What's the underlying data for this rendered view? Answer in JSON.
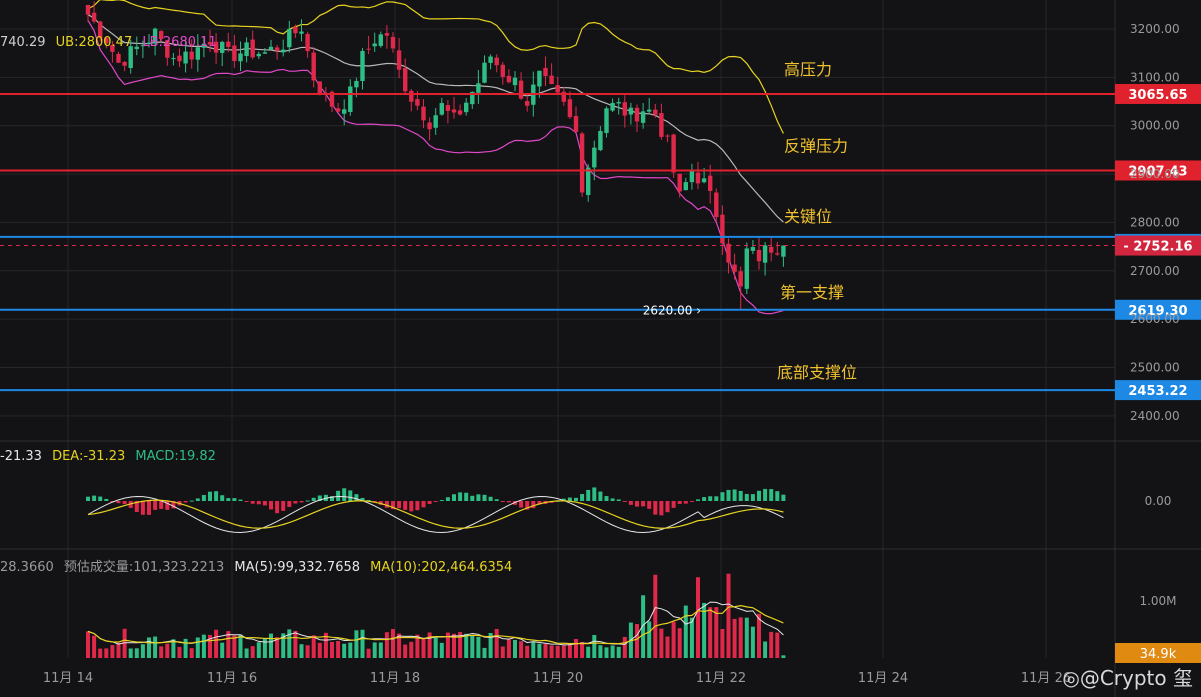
{
  "indicators": {
    "boll_mid": "740.29",
    "boll_ub": "UB:2800.47",
    "boll_lb": "LB:2680.11",
    "macd_dif": "-21.33",
    "macd_dea": "DEA:-31.23",
    "macd_macd": "MACD:19.82",
    "vol_cur": "28.3660",
    "vol_est": "预估成交量:101,323.2213",
    "vol_ma5": "MA(5):99,332.7658",
    "vol_ma10": "MA(10):202,464.6354"
  },
  "watermark": "◎@Crypto 玺",
  "colors": {
    "background": "#131316",
    "up": "#2ebd85",
    "down": "#e0294a",
    "upper_band": "#e6d21f",
    "lower_band": "#e048c8",
    "mid_band": "#b8b8b8",
    "resistance": "#e0212e",
    "support": "#1e88e5",
    "label": "#f0c22c",
    "grid": "#26262b",
    "axis_text": "#9a9a9a"
  },
  "chart_data": [
    {
      "type": "candlestick",
      "title": "",
      "ylim": [
        2350,
        3260
      ],
      "y_ticks": [
        2400,
        2500,
        2600,
        2700,
        2800,
        2900,
        3000,
        3100,
        3200
      ],
      "y_tick_labels": [
        "2400.00",
        "2500.00",
        "2600.00",
        "2700.00",
        "2800.00",
        "2900.00",
        "3000.00",
        "3100.00",
        "3200.00"
      ],
      "x_ticks": [
        "11月 14",
        "11月 16",
        "11月 18",
        "11月 20",
        "11月 22",
        "11月 24",
        "11月 26"
      ],
      "ohlc_anchors": [
        [
          0,
          3230
        ],
        [
          3,
          3180
        ],
        [
          5,
          3130
        ],
        [
          8,
          3160
        ],
        [
          11,
          3190
        ],
        [
          14,
          3140
        ],
        [
          17,
          3150
        ],
        [
          20,
          3180
        ],
        [
          23,
          3145
        ],
        [
          26,
          3155
        ],
        [
          29,
          3150
        ],
        [
          32,
          3170
        ],
        [
          35,
          3205
        ],
        [
          37,
          3100
        ],
        [
          39,
          3055
        ],
        [
          41,
          3035
        ],
        [
          43,
          3065
        ],
        [
          45,
          3140
        ],
        [
          47,
          3180
        ],
        [
          49,
          3190
        ],
        [
          51,
          3110
        ],
        [
          53,
          3060
        ],
        [
          56,
          3010
        ],
        [
          58,
          3040
        ],
        [
          60,
          3010
        ],
        [
          62,
          3050
        ],
        [
          64,
          3090
        ],
        [
          66,
          3145
        ],
        [
          68,
          3110
        ],
        [
          70,
          3090
        ],
        [
          72,
          3050
        ],
        [
          74,
          3100
        ],
        [
          76,
          3070
        ],
        [
          78,
          3040
        ],
        [
          80,
          2985
        ],
        [
          81,
          2880
        ],
        [
          83,
          2960
        ],
        [
          85,
          3040
        ],
        [
          87,
          3040
        ],
        [
          89,
          3020
        ],
        [
          91,
          3035
        ],
        [
          93,
          3025
        ],
        [
          95,
          2960
        ],
        [
          97,
          2850
        ],
        [
          99,
          2910
        ],
        [
          101,
          2880
        ],
        [
          103,
          2820
        ],
        [
          105,
          2730
        ],
        [
          106,
          2690
        ],
        [
          107,
          2660
        ],
        [
          108,
          2740
        ],
        [
          110,
          2730
        ],
        [
          112,
          2750
        ],
        [
          114,
          2752.16
        ]
      ],
      "resistance_levels": [
        {
          "label": "高压力",
          "value": 3065.65,
          "tag": "3065.65"
        },
        {
          "label": "反弹压力",
          "value": 2907.43,
          "tag": "2907.43"
        }
      ],
      "support_levels": [
        {
          "label": "关键位",
          "value": 2770.0,
          "tag": "2752.16"
        },
        {
          "label": "第一支撑",
          "value": 2619.3,
          "tag": "2619.30"
        },
        {
          "label": "底部支撑位",
          "value": 2453.22,
          "tag": "2453.22"
        }
      ],
      "current_price": 2752.16,
      "low_marker": "2620.00",
      "low_marker_value": 2620.0
    },
    {
      "type": "bar",
      "title": "MACD",
      "ylim": [
        -60,
        50
      ],
      "y_tick_labels": [
        "0.00"
      ],
      "histogram_wave": [
        8,
        -14,
        9,
        -10,
        12,
        -12,
        10,
        -8,
        11,
        -13,
        9,
        10
      ]
    },
    {
      "type": "bar",
      "title": "Volume",
      "ylim": [
        0,
        1300000
      ],
      "y_tick_labels": [
        "1.00M"
      ],
      "current_volume_tag": "34.9k"
    }
  ]
}
